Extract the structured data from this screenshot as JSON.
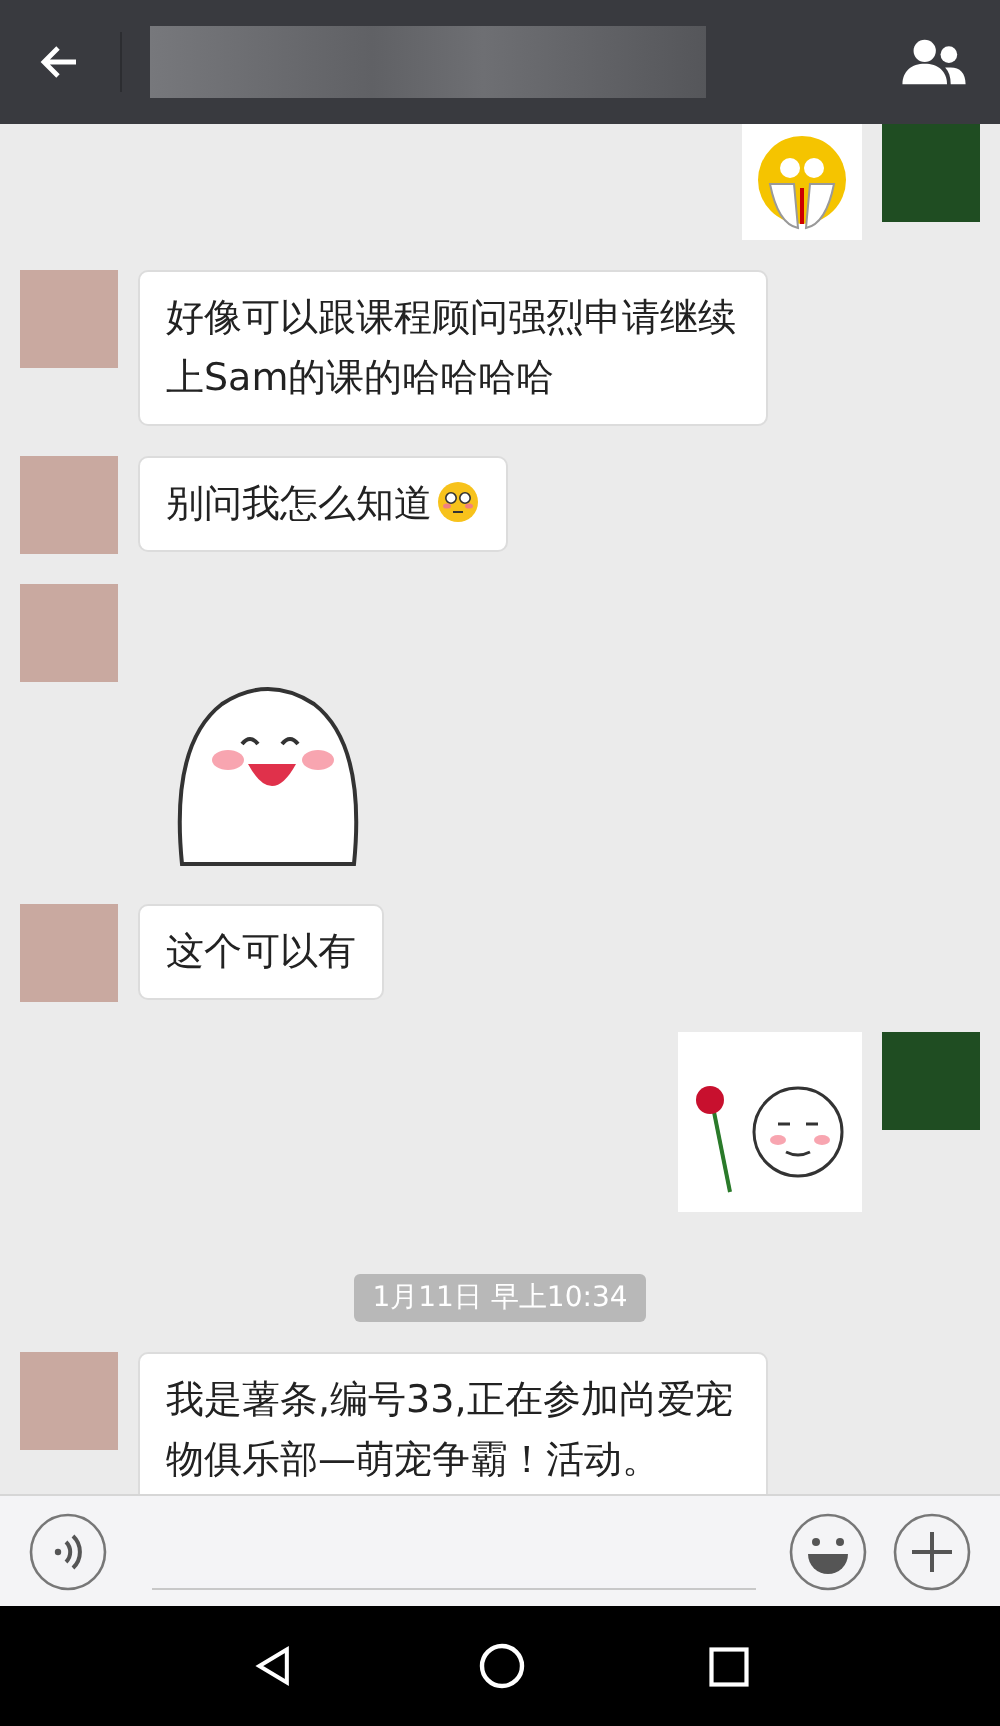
{
  "messages": [
    {
      "kind": "emojisticker",
      "outgoing": true
    },
    {
      "kind": "text",
      "outgoing": false,
      "text": "好像可以跟课程顾问强烈申请继续上Sam的课的哈哈哈哈"
    },
    {
      "kind": "text",
      "outgoing": false,
      "text": "别问我怎么知道",
      "emoji": true
    },
    {
      "kind": "laughsticker",
      "outgoing": false
    },
    {
      "kind": "text",
      "outgoing": false,
      "text": "这个可以有"
    },
    {
      "kind": "rosesticker",
      "outgoing": true
    },
    {
      "kind": "time",
      "text": "1月11日 早上10:34"
    },
    {
      "kind": "text",
      "outgoing": false,
      "text": "我是薯条,编号33,正在参加尚爱宠物俱乐部—萌宠争霸！活动。",
      "cut": true
    }
  ]
}
